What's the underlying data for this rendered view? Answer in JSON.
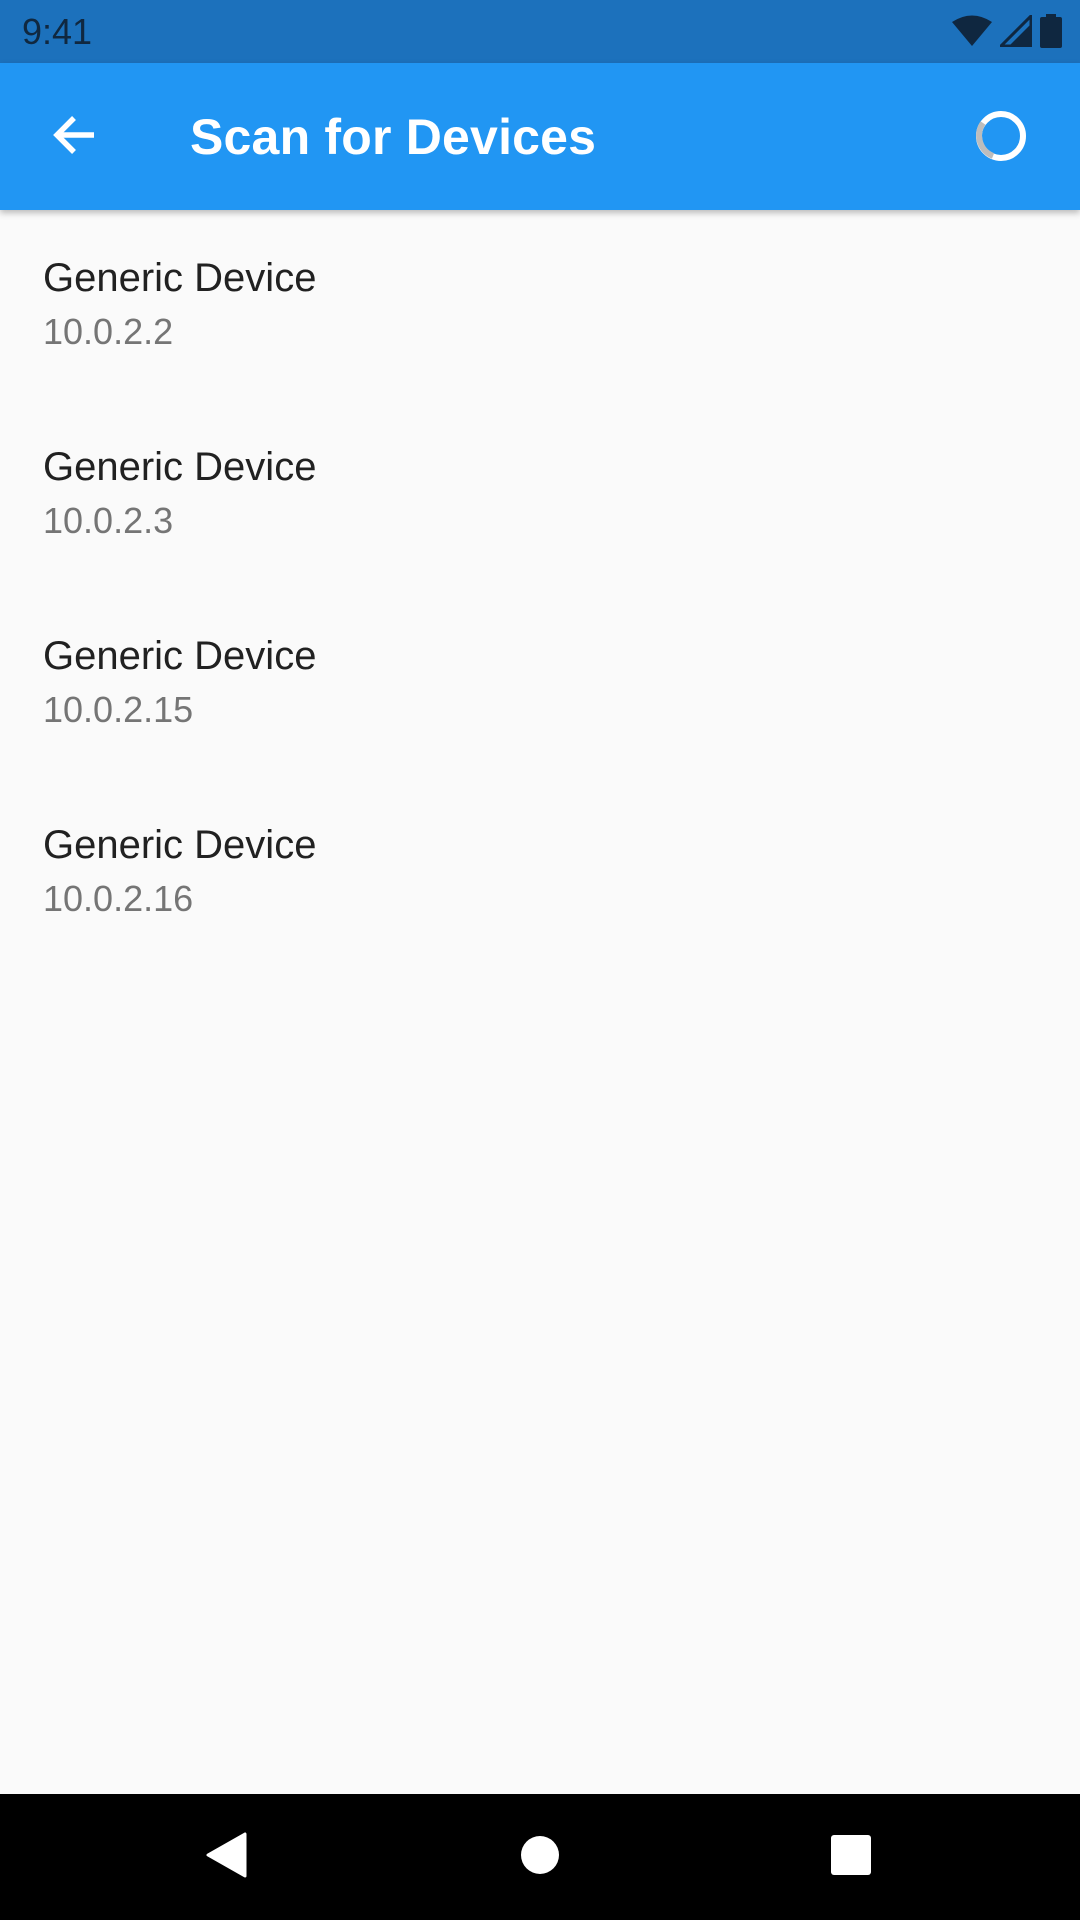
{
  "status_bar": {
    "time": "9:41",
    "icons": [
      "wifi-icon",
      "cell-signal-icon",
      "battery-icon"
    ],
    "color": "#1C71BC"
  },
  "app_bar": {
    "title": "Scan for Devices",
    "color": "#2196F3",
    "leading_icon": "arrow-back-icon",
    "trailing_icon": "progress-spinner-icon"
  },
  "devices": [
    {
      "name": "Generic Device",
      "address": "10.0.2.2"
    },
    {
      "name": "Generic Device",
      "address": "10.0.2.3"
    },
    {
      "name": "Generic Device",
      "address": "10.0.2.15"
    },
    {
      "name": "Generic Device",
      "address": "10.0.2.16"
    }
  ],
  "nav_bar": {
    "icons": [
      "nav-back-icon",
      "nav-home-icon",
      "nav-recents-icon"
    ]
  }
}
